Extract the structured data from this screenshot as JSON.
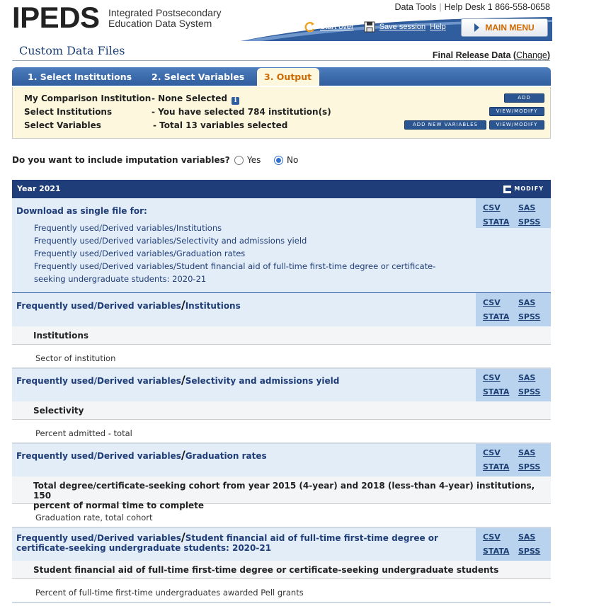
{
  "header": {
    "logo": "IPEDS",
    "subtitle_line1": "Integrated Postsecondary",
    "subtitle_line2": "Education Data System",
    "data_tools": "Data Tools",
    "help_desk": "Help Desk 1 866-558-0658",
    "start_over": "Start over",
    "save_session": "Save session",
    "help": "Help",
    "main_menu": "MAIN MENU"
  },
  "page": {
    "title": "Custom Data Files",
    "release_label": "Final Release Data",
    "change_link": "Change"
  },
  "steps": [
    "1. Select Institutions",
    "2. Select Variables",
    "3. Output"
  ],
  "selection": {
    "comparison_label": "My Comparison Institution",
    "comparison_value": "- None Selected",
    "institutions_label": "Select Institutions",
    "institutions_value": "- You have selected 784 institution(s)",
    "variables_label": "Select Variables",
    "variables_value": "- Total 13 variables selected",
    "add_button": "ADD",
    "view_modify_button": "VIEW/MODIFY",
    "add_new_variables_button": "ADD NEW VARIABLES"
  },
  "imputation": {
    "question": "Do you want to include imputation variables?",
    "yes": "Yes",
    "no": "No",
    "selected": "No"
  },
  "year": {
    "label": "Year 2021",
    "modify": "MODIFY"
  },
  "formats": {
    "csv": "CSV",
    "sas": "SAS",
    "stata": "STATA",
    "spss": "SPSS"
  },
  "single_file": {
    "heading": "Download as single file for:",
    "files": [
      "Frequently used/Derived variables/Institutions",
      "Frequently used/Derived variables/Selectivity and admissions yield",
      "Frequently used/Derived variables/Graduation rates",
      "Frequently used/Derived variables/Student financial aid of full-time first-time degree or certificate-",
      "seeking undergraduate students: 2020-21"
    ]
  },
  "sections": [
    {
      "prefix": "Frequently used/Derived variables",
      "name": "Institutions",
      "subheading": "Institutions",
      "variable": "Sector of institution"
    },
    {
      "prefix": "Frequently used/Derived variables",
      "name": "Selectivity and admissions yield",
      "subheading": "Selectivity",
      "variable": "Percent admitted - total"
    },
    {
      "prefix": "Frequently used/Derived variables",
      "name": "Graduation rates",
      "subheading_line1": "Total degree/certificate-seeking cohort from year 2015 (4-year) and 2018 (less-than 4-year) institutions, 150",
      "subheading_line2": "percent of normal time to complete",
      "variable": "Graduation rate, total cohort"
    },
    {
      "prefix": "Frequently used/Derived variables",
      "name_line1": "Student financial aid of full-time first-time degree or",
      "name_line2": "certificate-seeking undergraduate students: 2020-21",
      "subheading": "Student financial aid of full-time first-time degree or certificate-seeking undergraduate students",
      "variable": "Percent of full-time first-time undergraduates awarded Pell grants"
    }
  ],
  "colors": {
    "primary_blue": "#1f3d78",
    "accent_orange": "#d06a00",
    "highlight_yellow": "#fdf8dd",
    "panel_blue": "#e3edf7"
  }
}
